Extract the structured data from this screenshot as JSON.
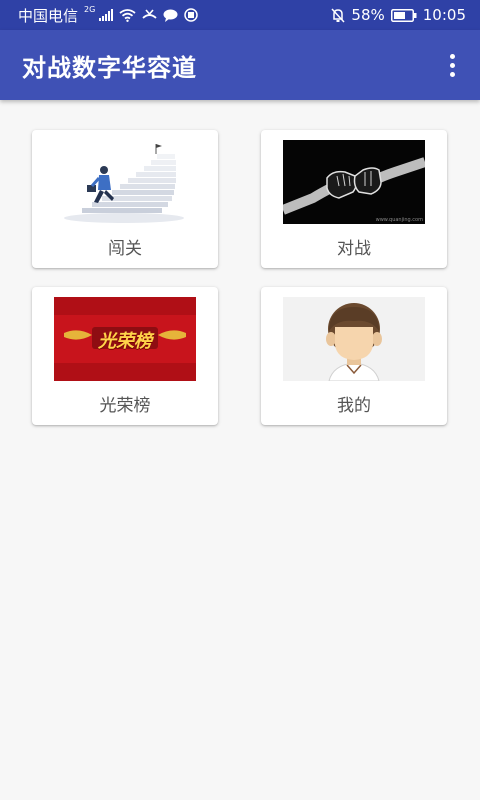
{
  "status_bar": {
    "carrier": "中国电信",
    "network_tag": "2G",
    "battery": "58%",
    "time": "10:05",
    "icons": [
      "signal-icon",
      "wifi-icon",
      "missed-call-icon",
      "message-icon",
      "app-notification-icon",
      "mute-bell-icon",
      "battery-icon"
    ]
  },
  "app_bar": {
    "title": "对战数字华容道",
    "menu_icon": "more-vert-icon",
    "color": "#3f51b5"
  },
  "menu": {
    "items": [
      {
        "label": "闯关",
        "image": "stairs-climber-illustration"
      },
      {
        "label": "对战",
        "image": "fist-bump-illustration",
        "image_caption": "www.quanjing.com"
      },
      {
        "label": "光荣榜",
        "image": "honor-banner",
        "banner_text": "光荣榜"
      },
      {
        "label": "我的",
        "image": "avatar-illustration"
      }
    ]
  }
}
